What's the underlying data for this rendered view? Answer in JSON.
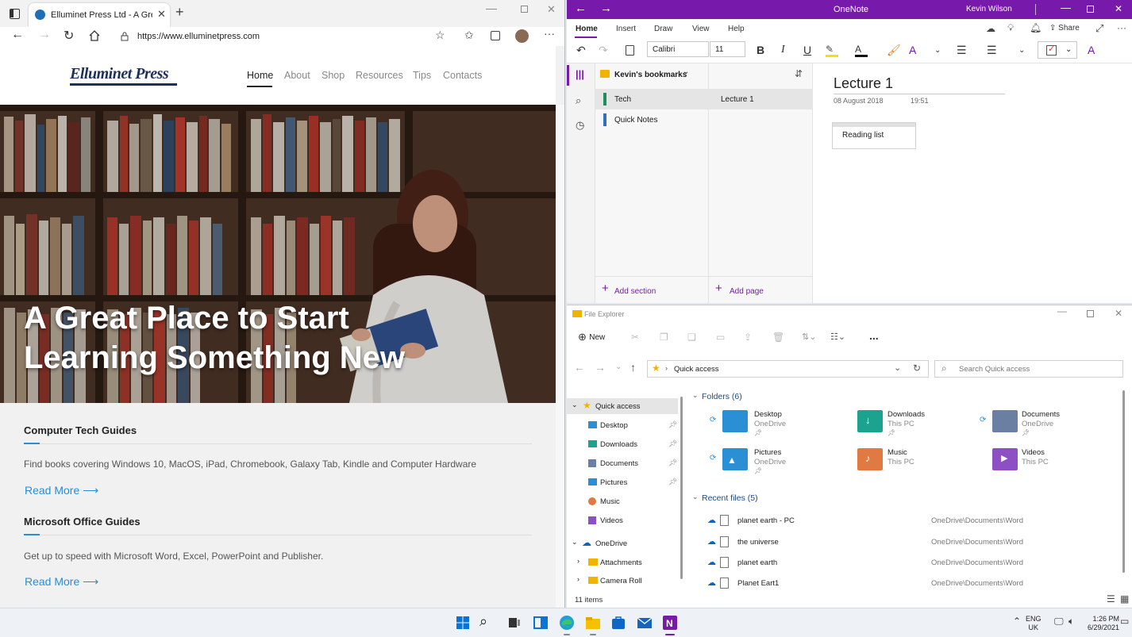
{
  "browser": {
    "tab_title": "Elluminet Press Ltd - A Great Pla",
    "url": "https://www.elluminetpress.com",
    "site": {
      "logo": "Elluminet Press",
      "nav": [
        "Home",
        "About",
        "Shop",
        "Resources",
        "Tips",
        "Contacts"
      ],
      "hero_line1": "A Great Place to Start",
      "hero_line2": "Learning Something New",
      "sections": [
        {
          "title": "Computer Tech Guides",
          "text": "Find books covering Windows 10, MacOS, iPad, Chromebook, Galaxy Tab, Kindle and Computer Hardware",
          "link": "Read More"
        },
        {
          "title": "Microsoft Office Guides",
          "text": "Get up to speed with Microsoft Word, Excel, PowerPoint and Publisher.",
          "link": "Read More"
        }
      ]
    }
  },
  "onenote": {
    "app_title": "OneNote",
    "user": "Kevin Wilson",
    "tabs": [
      "Home",
      "Insert",
      "Draw",
      "View",
      "Help"
    ],
    "share": "Share",
    "font": "Calibri",
    "font_size": "11",
    "notebook": "Kevin's bookmarks",
    "sections": [
      "Tech",
      "Quick Notes"
    ],
    "pages": [
      "Lecture 1"
    ],
    "add_section": "Add section",
    "add_page": "Add page",
    "page_title": "Lecture 1",
    "page_date": "08 August 2018",
    "page_time": "19:51",
    "note_text": "Reading list"
  },
  "explorer": {
    "title": "File Explorer",
    "new_label": "New",
    "more": "...",
    "breadcrumb": "Quick access",
    "search_placeholder": "Search Quick access",
    "tree": [
      "Quick access",
      "Desktop",
      "Downloads",
      "Documents",
      "Pictures",
      "Music",
      "Videos",
      "OneDrive",
      "Attachments",
      "Camera Roll"
    ],
    "folders_header": "Folders (6)",
    "folders": [
      {
        "name": "Desktop",
        "sub": "OneDrive",
        "color": "#2b8fd6"
      },
      {
        "name": "Downloads",
        "sub": "This PC",
        "color": "#1ba390"
      },
      {
        "name": "Documents",
        "sub": "OneDrive",
        "color": "#6b7fa3"
      },
      {
        "name": "Pictures",
        "sub": "OneDrive",
        "color": "#2b8fd6"
      },
      {
        "name": "Music",
        "sub": "This PC",
        "color": "#e07a42"
      },
      {
        "name": "Videos",
        "sub": "This PC",
        "color": "#8d4fc4"
      }
    ],
    "recent_header": "Recent files (5)",
    "recent": [
      {
        "name": "planet earth - PC",
        "path": "OneDrive\\Documents\\Word"
      },
      {
        "name": "the universe",
        "path": "OneDrive\\Documents\\Word"
      },
      {
        "name": "planet earth",
        "path": "OneDrive\\Documents\\Word"
      },
      {
        "name": "Planet Eart1",
        "path": "OneDrive\\Documents\\Word"
      }
    ],
    "status": "11 items"
  },
  "taskbar": {
    "lang1": "ENG",
    "lang2": "UK",
    "time": "1:26 PM",
    "date": "6/29/2021"
  }
}
